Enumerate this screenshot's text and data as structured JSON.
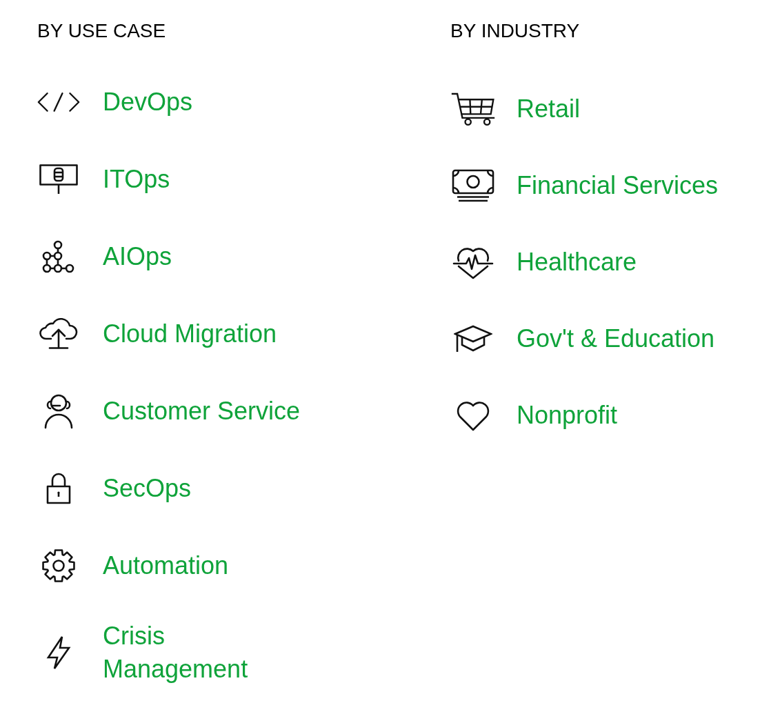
{
  "columns": [
    {
      "heading": "BY USE CASE",
      "items": [
        {
          "label": "DevOps"
        },
        {
          "label": "ITOps"
        },
        {
          "label": "AIOps"
        },
        {
          "label": "Cloud Migration"
        },
        {
          "label": "Customer Service"
        },
        {
          "label": "SecOps"
        },
        {
          "label": "Automation"
        },
        {
          "label": "Crisis Management"
        }
      ]
    },
    {
      "heading": "BY INDUSTRY",
      "items": [
        {
          "label": "Retail"
        },
        {
          "label": "Financial Services"
        },
        {
          "label": "Healthcare"
        },
        {
          "label": "Gov't & Education"
        },
        {
          "label": "Nonprofit"
        }
      ]
    }
  ]
}
